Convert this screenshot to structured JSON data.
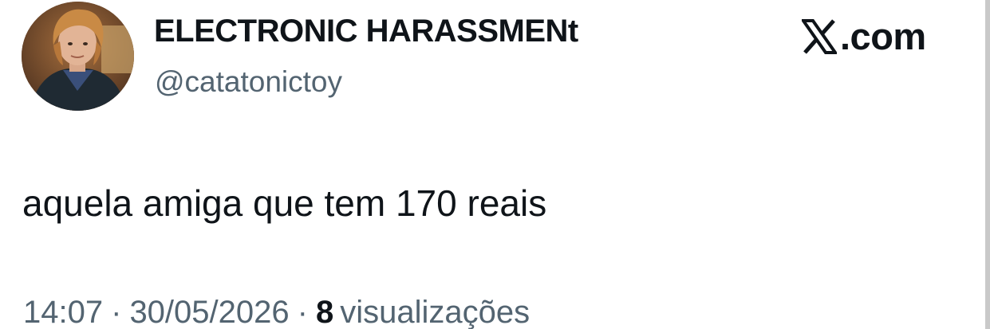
{
  "author": {
    "display_name": "ELECTRONIC HARASSMENt",
    "handle": "@catatonictoy"
  },
  "brand": {
    "icon": "x-logo-icon",
    "label": ".com"
  },
  "tweet": {
    "text": "aquela amiga que tem 170 reais"
  },
  "meta": {
    "time": "14:07",
    "separator": "·",
    "date": "30/05/2026",
    "views_count": "8",
    "views_label": "visualizações"
  },
  "colors": {
    "text_primary": "#0f1419",
    "text_secondary": "#536471",
    "background": "#ffffff"
  }
}
